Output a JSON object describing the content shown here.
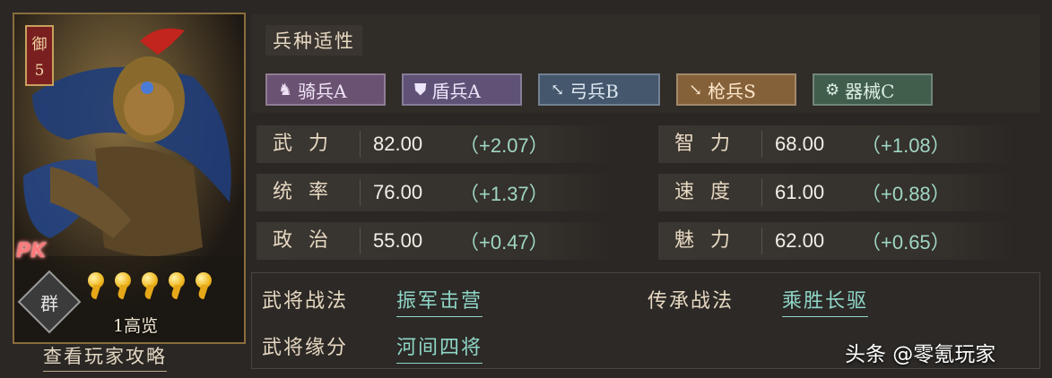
{
  "card": {
    "rank_label": "御",
    "rank_level": "5",
    "pk_badge": "PK",
    "faction": "群",
    "stars": 5,
    "cost": "1高览",
    "strategy_link": "查看玩家攻略"
  },
  "troops": {
    "title": "兵种适性",
    "items": [
      {
        "icon": "horse-icon",
        "label": "骑兵A",
        "color": "#6a5272"
      },
      {
        "icon": "shield-icon",
        "label": "盾兵A",
        "color": "#5f5276"
      },
      {
        "icon": "bow-icon",
        "label": "弓兵B",
        "color": "#44576c"
      },
      {
        "icon": "spear-icon",
        "label": "枪兵S",
        "color": "#85613a"
      },
      {
        "icon": "gear-icon",
        "label": "器械C",
        "color": "#415e4c"
      }
    ]
  },
  "attributes": {
    "left": [
      {
        "name": "武力",
        "value": "82.00",
        "bonus": "（+2.07）"
      },
      {
        "name": "统率",
        "value": "76.00",
        "bonus": "（+1.37）"
      },
      {
        "name": "政治",
        "value": "55.00",
        "bonus": "（+0.47）"
      }
    ],
    "right": [
      {
        "name": "智力",
        "value": "68.00",
        "bonus": "（+1.08）"
      },
      {
        "name": "速度",
        "value": "61.00",
        "bonus": "（+0.88）"
      },
      {
        "name": "魅力",
        "value": "62.00",
        "bonus": "（+0.65）"
      }
    ]
  },
  "tactics": {
    "general_tactic_label": "武将战法",
    "general_tactic_value": "振军击营",
    "inherit_tactic_label": "传承战法",
    "inherit_tactic_value": "乘胜长驱",
    "bond_label": "武将缘分",
    "bond_value": "河间四将"
  },
  "watermark": "头条 @零氪玩家"
}
